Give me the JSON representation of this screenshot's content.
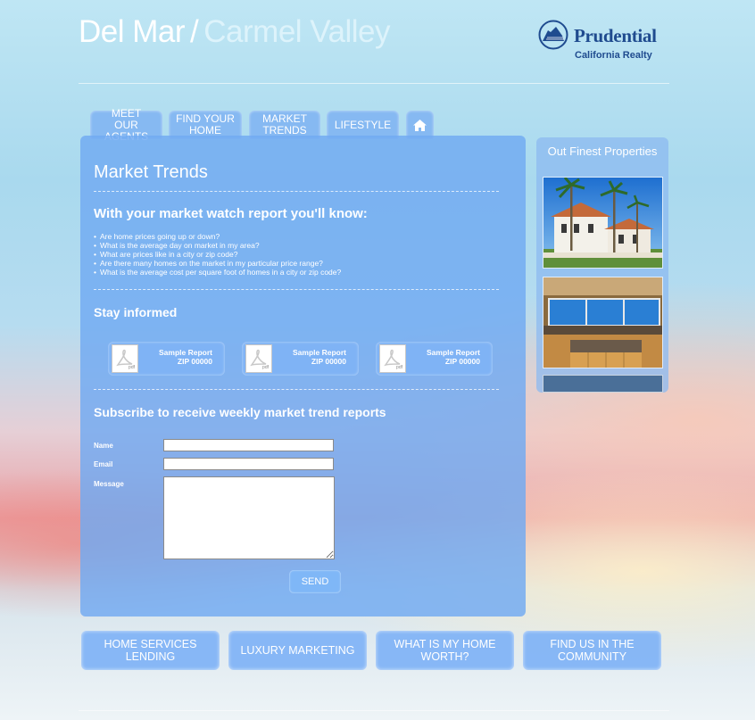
{
  "header": {
    "title_part1": "Del Mar",
    "separator": "/",
    "title_part2": "Carmel Valley",
    "logo": {
      "name": "Prudential",
      "subtitle": "California Realty",
      "color": "#1f4b8f",
      "icon": "rock-of-gibraltar-icon"
    }
  },
  "nav": {
    "tabs": [
      {
        "label": "MEET OUR AGENTS"
      },
      {
        "label": "FIND YOUR HOME"
      },
      {
        "label": "MARKET TRENDS"
      },
      {
        "label": "LIFESTYLE"
      }
    ],
    "home_icon": "home-icon"
  },
  "main": {
    "title": "Market Trends",
    "watch_heading": "With your market watch report you'll know:",
    "bullets": [
      "Are home prices going up or down?",
      "What is the average day on market in my area?",
      "What are prices like in a city or zip code?",
      "Are there many homes on the market in my particular price range?",
      "What is the average cost per square foot of homes in a city or zip code?"
    ],
    "informed_heading": "Stay informed",
    "reports": [
      {
        "line1": "Sample Report",
        "line2": "ZIP 00000",
        "file_badge": "pdf"
      },
      {
        "line1": "Sample Report",
        "line2": "ZIP 00000",
        "file_badge": "pdf"
      },
      {
        "line1": "Sample Report",
        "line2": "ZIP 00000",
        "file_badge": "pdf"
      }
    ],
    "subscribe_heading": "Subscribe to receive weekly market trend reports",
    "form": {
      "name_label": "Name",
      "email_label": "Email",
      "message_label": "Message",
      "name_value": "",
      "email_value": "",
      "message_value": "",
      "send_label": "SEND"
    }
  },
  "sidebar": {
    "title": "Out Finest Properties"
  },
  "footer_buttons": [
    {
      "label": "HOME SERVICES LENDING"
    },
    {
      "label": "LUXURY MARKETING"
    },
    {
      "label": "WHAT IS MY HOME WORTH?"
    },
    {
      "label": "FIND US IN THE COMMUNITY"
    }
  ],
  "colors": {
    "panel": "#70aaf2",
    "brand": "#1f4b8f",
    "text": "#ffffff"
  }
}
